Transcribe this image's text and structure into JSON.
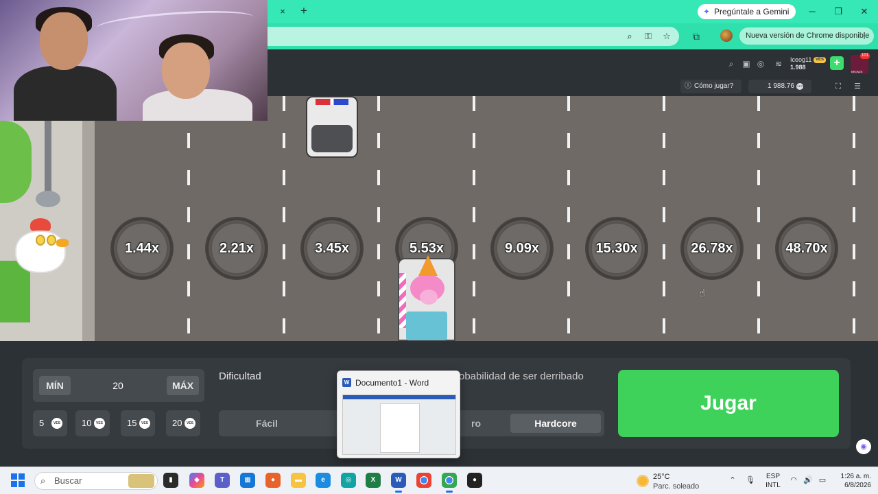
{
  "browser": {
    "tab_close": "×",
    "tab_new": "+",
    "gemini_label": "Pregúntale a Gemini",
    "update_label": "Nueva versión de Chrome disponible"
  },
  "site": {
    "username": "Iceog11",
    "currency": "VES",
    "wallet_balance": "1.988",
    "rank_badge": "101",
    "rank_label": "BRONZE",
    "how_to_play": "Cómo jugar?",
    "game_balance": "1 988.76"
  },
  "game": {
    "multipliers": [
      "1.44x",
      "2.21x",
      "3.45x",
      "5.53x",
      "9.09x",
      "15.30x",
      "26.78x",
      "48.70x"
    ]
  },
  "controls": {
    "min_label": "MÍN",
    "max_label": "MÁX",
    "bet_value": "20",
    "chips": [
      {
        "value": "5",
        "currency": "VES"
      },
      {
        "value": "10",
        "currency": "VES"
      },
      {
        "value": "15",
        "currency": "VES"
      },
      {
        "value": "20",
        "currency": "VES"
      }
    ],
    "difficulty_label": "Dificultad",
    "probability_label": "robabilidad de ser derribado",
    "difficulty_options": [
      {
        "label": "Fácil",
        "active": false
      },
      {
        "label": "ro",
        "active": false
      },
      {
        "label": "Hardcore",
        "active": true
      }
    ],
    "play_label": "Jugar"
  },
  "word_preview": {
    "title": "Documento1 - Word"
  },
  "taskbar": {
    "search_placeholder": "Buscar",
    "weather_temp": "25°C",
    "weather_desc": "Parc. soleado",
    "lang_1": "ESP",
    "lang_2": "INTL",
    "time": "1:26 a. m.",
    "date": "6/8/2026"
  },
  "colors": {
    "chrome_tab": "#35e8b6",
    "play_button": "#3ed25a",
    "panel": "#353a3f"
  }
}
